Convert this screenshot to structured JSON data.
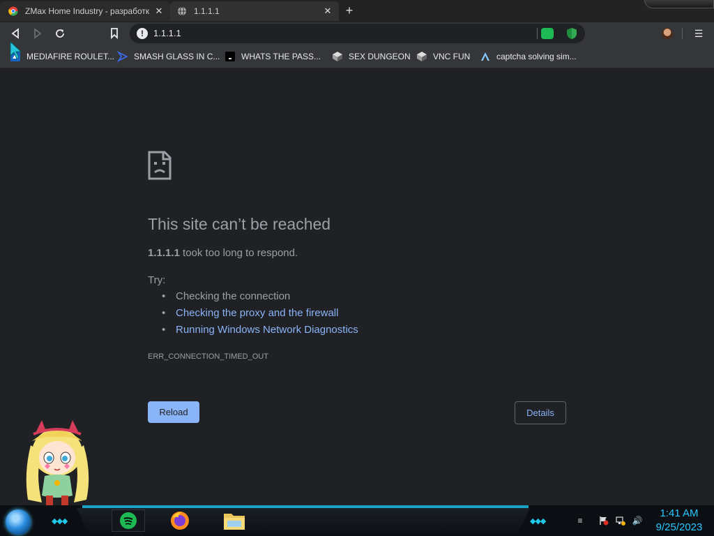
{
  "tabs": [
    {
      "title": "ZMax Home Industry - разработк",
      "favicon": "chrome-icon"
    },
    {
      "title": "1.1.1.1",
      "favicon": "globe-icon"
    }
  ],
  "toolbar": {
    "url": "1.1.1.1"
  },
  "bookmarks": [
    {
      "label": "MEDIAFIRE ROULET...",
      "icon": "mediafire-icon"
    },
    {
      "label": "SMASH GLASS IN C...",
      "icon": "visualstudio-icon"
    },
    {
      "label": "WHATS THE PASS...",
      "icon": "terminal-icon"
    },
    {
      "label": "SEX DUNGEON",
      "icon": "dungeon-icon"
    },
    {
      "label": "VNC FUN",
      "icon": "vnc-icon"
    },
    {
      "label": "captcha solving sim...",
      "icon": "vercel-icon"
    }
  ],
  "error": {
    "title": "This site can’t be reached",
    "host": "1.1.1.1",
    "message": " took too long to respond.",
    "try_label": "Try:",
    "suggestions": [
      "Checking the connection",
      "Checking the proxy and the firewall",
      "Running Windows Network Diagnostics"
    ],
    "code": "ERR_CONNECTION_TIMED_OUT",
    "reload": "Reload",
    "details": "Details"
  },
  "clock": {
    "time": "1:41 AM",
    "date": "9/25/2023"
  },
  "colors": {
    "link": "#8ab4f8",
    "accent": "#27c9ff"
  }
}
